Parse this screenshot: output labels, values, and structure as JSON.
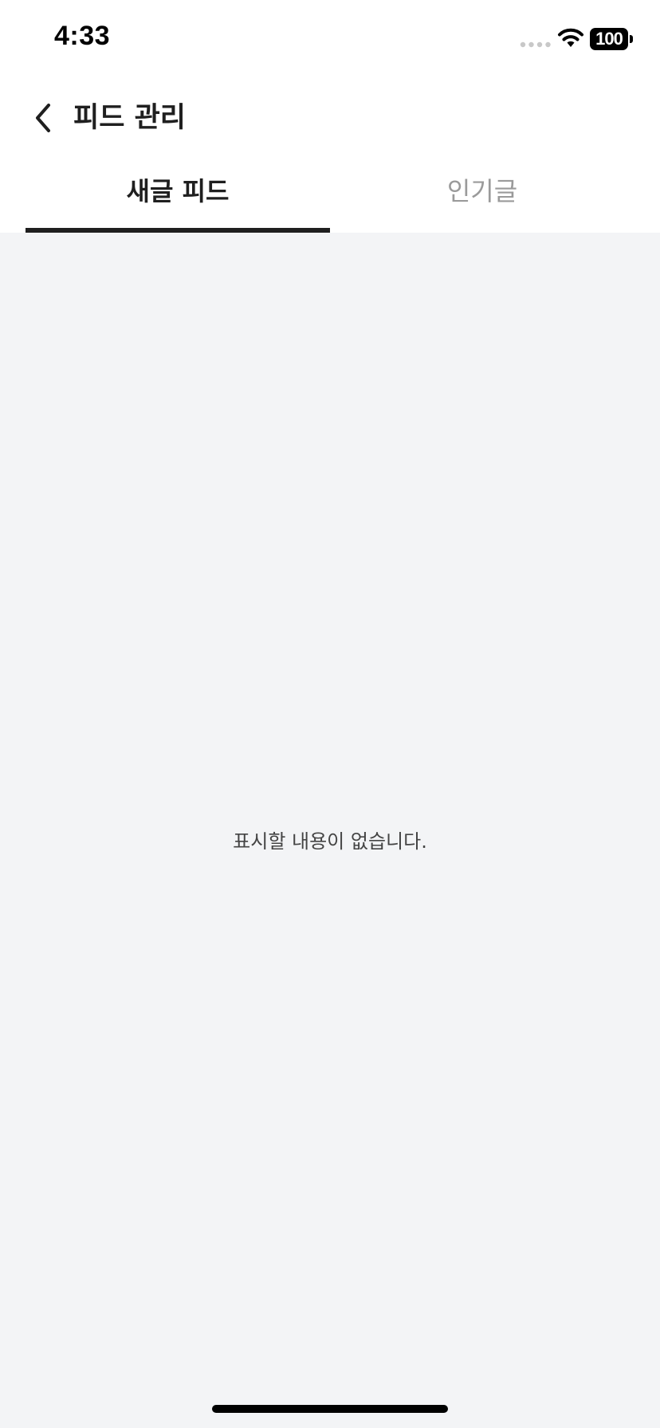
{
  "status_bar": {
    "time": "4:33",
    "battery": "100",
    "icons": [
      "signal-dots-icon",
      "wifi-icon",
      "battery-icon"
    ]
  },
  "nav": {
    "title": "피드 관리",
    "back_icon": "chevron-left-icon"
  },
  "tabs": [
    {
      "label": "새글 피드",
      "selected": true
    },
    {
      "label": "인기글",
      "selected": false
    }
  ],
  "content": {
    "empty_message": "표시할 내용이 없습니다."
  },
  "colors": {
    "background": "#f3f4f6",
    "header_bg": "#ffffff",
    "active_tab": "#1f1f1f",
    "inactive_tab": "#9a9a9a"
  }
}
